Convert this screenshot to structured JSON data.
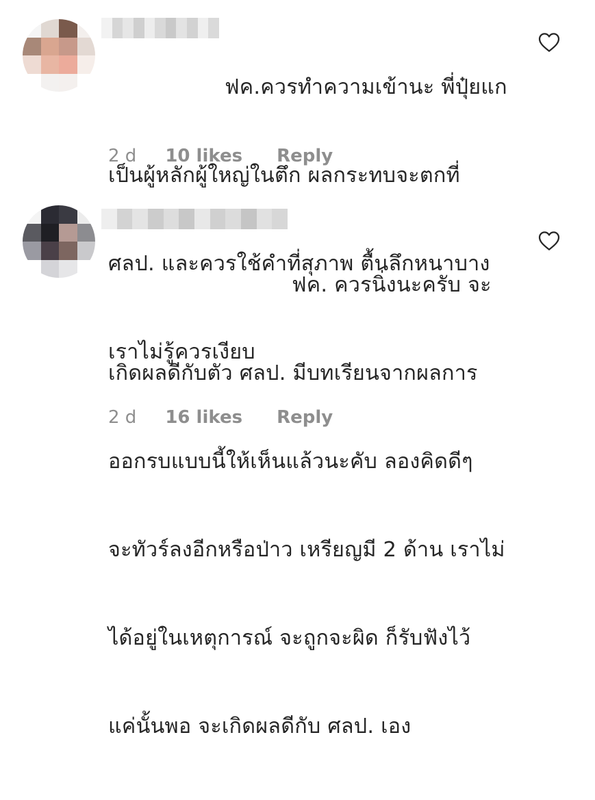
{
  "comments": [
    {
      "text_lines": [
        "ฟค.ควรทำความเข้านะ พี่ปุ๋ยแก",
        "เป็นผู้หลักผู้ใหญ่ในตึก ผลกระทบจะตกที่",
        "ศลป. และควรใช้คำที่สุภาพ ตื้นลึกหนาบาง",
        "เราไม่รู้ควรเงียบ"
      ],
      "age": "2 d",
      "likes": "10 likes",
      "reply": "Reply",
      "avatar_colors": [
        "#f5f5f5",
        "#e0d8d2",
        "#7a5a4c",
        "#f3efed",
        "#a88878",
        "#d9a690",
        "#c7998a",
        "#e3d9d3",
        "#eedbd3",
        "#e8b6a3",
        "#ecab9b",
        "#f6eeea",
        "#ffffff",
        "#f3f1f0",
        "#f4f0ee",
        "#ffffff"
      ],
      "name_blur_colors": [
        "#f2f2f2",
        "#d6d6d6",
        "#e6e6e6",
        "#cfcfcf",
        "#ededed",
        "#d9d9d9",
        "#c9c9c9",
        "#e3e3e3",
        "#d2d2d2",
        "#efefef",
        "#dadada"
      ]
    },
    {
      "text_lines": [
        "ฟค. ควรนิ่งนะครับ จะ",
        "เกิดผลดีกับตัว ศลป. มีบทเรียนจากผลการ",
        "ออกรบแบบนี้ให้เห็นแล้วนะคับ ลองคิดดีๆ",
        "จะทัวร์ลงอีกหรือป่าว เหรียญมี 2 ด้าน เราไม่",
        "ได้อยู่ในเหตุการณ์ จะถูกจะผิด ก็รับฟังไว้",
        "แค่นั้นพอ จะเกิดผลดีกับ ศลป. เอง"
      ],
      "age": "2 d",
      "likes": "16 likes",
      "reply": "Reply",
      "avatar_colors": [
        "#f4f4f4",
        "#2b2b33",
        "#3a3a42",
        "#ececec",
        "#5a5a60",
        "#1f1f24",
        "#b59a94",
        "#8c8c90",
        "#9a9aa2",
        "#4a4048",
        "#7d6660",
        "#c9c9cc",
        "#ffffff",
        "#d4d4d8",
        "#e6e6e8",
        "#ffffff"
      ],
      "name_blur_colors": [
        "#eeeeee",
        "#d3d3d3",
        "#e4e4e4",
        "#cccccc",
        "#dddddd",
        "#c8c8c8",
        "#e8e8e8",
        "#d0d0d0",
        "#dcdcdc",
        "#c5c5c5",
        "#e1e1e1",
        "#d7d7d7"
      ]
    }
  ],
  "icons": {
    "like": "heart-outline-icon"
  },
  "colors": {
    "text": "#262626",
    "meta": "#8e8e8e",
    "heart_stroke": "#262626"
  }
}
